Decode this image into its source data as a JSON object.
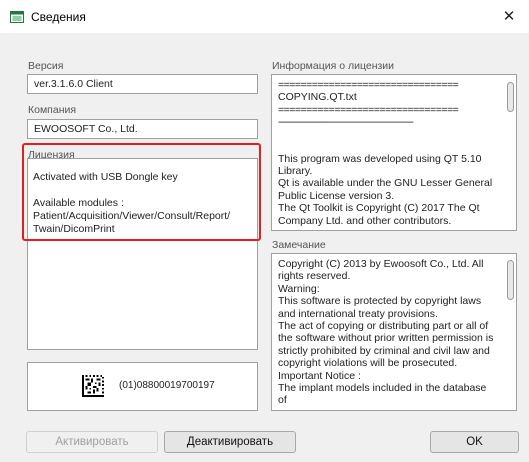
{
  "window": {
    "title": "Сведения",
    "close_glyph": "✕",
    "icon": "app-window-icon",
    "accent": "#1e7b3c"
  },
  "version": {
    "label": "Версия",
    "value": "ver.3.1.6.0 Client"
  },
  "company": {
    "label": "Компания",
    "value": "EWOOSOFT Co., Ltd."
  },
  "license": {
    "label": "Лицензия",
    "lines": [
      "Activated with USB Dongle key",
      "",
      "Available modules :",
      "Patient/Acquisition/Viewer/Consult/Report/",
      "Twain/DicomPrint"
    ],
    "highlight_color": "#e02020"
  },
  "license_info": {
    "label": "Информация о лицензии",
    "lines": [
      "================================",
      "COPYING.QT.txt",
      "================================",
      "------------------------------------------------------",
      "",
      "",
      "This program was developed using QT 5.10",
      "Library.",
      "Qt is available under the GNU Lesser General",
      "Public License version 3.",
      "The Qt Toolkit is Copyright (C) 2017 The Qt",
      "Company Ltd. and other contributors."
    ]
  },
  "remark": {
    "label": "Замечание",
    "lines": [
      "Copyright (C) 2013 by Ewoosoft Co., Ltd. All",
      "rights reserved.",
      "Warning:",
      "This software is protected by copyright laws",
      "and international treaty provisions.",
      "The act of copying or distributing part or all of",
      "the software without prior written permission is",
      "strictly prohibited by criminal and civil law and",
      "copyright violations will be prosecuted.",
      "Important Notice :",
      "The implant models included in the database of"
    ]
  },
  "dongle": {
    "code": "(01)08800019700197",
    "icon": "datamatrix-code-icon"
  },
  "buttons": {
    "activate": "Активировать",
    "deactivate": "Деактивировать",
    "ok": "OK"
  }
}
